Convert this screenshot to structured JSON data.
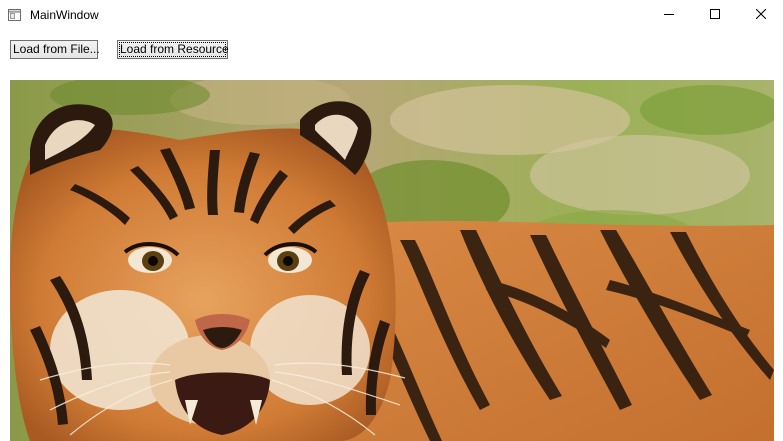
{
  "window": {
    "title": "MainWindow"
  },
  "toolbar": {
    "load_file_label": "Load from File...",
    "load_resource_label": "Load from Resource"
  },
  "image": {
    "subject": "tiger-photo"
  },
  "icons": {
    "app": "window-app-icon",
    "minimize": "minimize-icon",
    "maximize": "maximize-icon",
    "close": "close-icon"
  },
  "colors": {
    "titlebar_bg": "#ffffff",
    "button_border": "#707070",
    "button_bg": "#e5e5e5"
  }
}
